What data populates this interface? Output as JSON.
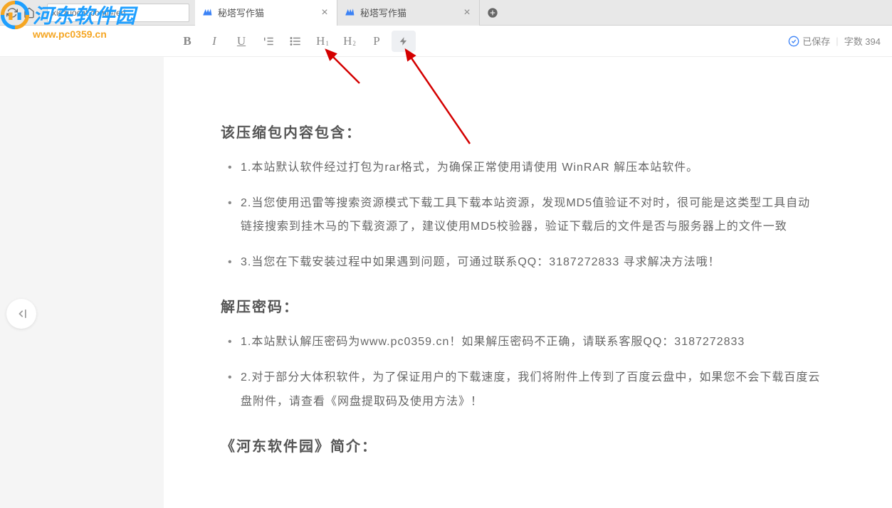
{
  "browser": {
    "url": "xiezuocat.com/#/ed",
    "tabs": [
      {
        "title": "秘塔写作猫"
      },
      {
        "title": "秘塔写作猫"
      }
    ]
  },
  "toolbar": {
    "bold": "B",
    "italic": "I",
    "underline": "U",
    "h1_main": "H",
    "h1_sub": "1",
    "h2_main": "H",
    "h2_sub": "2",
    "paragraph": "P"
  },
  "status": {
    "saved_label": "已保存",
    "word_count_label": "字数 394"
  },
  "document": {
    "heading1": "该压缩包内容包含：",
    "list1": [
      "1.本站默认软件经过打包为rar格式，为确保正常使用请使用 WinRAR 解压本站软件。",
      "2.当您使用迅雷等搜索资源模式下载工具下载本站资源，发现MD5值验证不对时，很可能是这类型工具自动链接搜索到挂木马的下载资源了，建议使用MD5校验器，验证下载后的文件是否与服务器上的文件一致",
      "3.当您在下载安装过程中如果遇到问题，可通过联系QQ：3187272833 寻求解决方法哦！"
    ],
    "heading2": "解压密码：",
    "list2": [
      "1.本站默认解压密码为www.pc0359.cn！如果解压密码不正确，请联系客服QQ：3187272833",
      "2.对于部分大体积软件，为了保证用户的下载速度，我们将附件上传到了百度云盘中，如果您不会下载百度云盘附件，请查看《网盘提取码及使用方法》！"
    ],
    "heading3": "《河东软件园》简介："
  },
  "watermark": {
    "name": "河东软件园",
    "url": "www.pc0359.cn"
  }
}
